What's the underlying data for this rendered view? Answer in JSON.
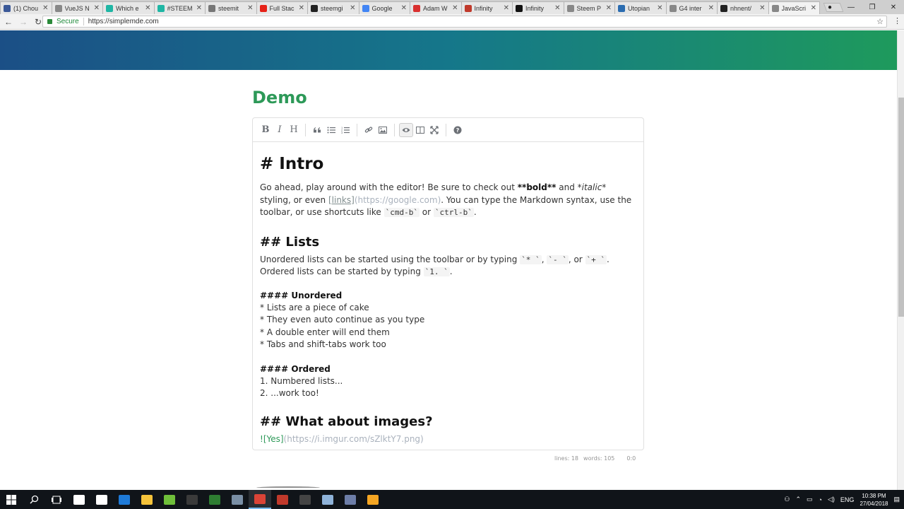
{
  "browser": {
    "tabs": [
      {
        "label": "(1) Chou",
        "color": "#3b5998"
      },
      {
        "label": "VueJS N",
        "color": "#888888"
      },
      {
        "label": "Which e",
        "color": "#1fb6a4"
      },
      {
        "label": "#STEEM",
        "color": "#1fb6a4"
      },
      {
        "label": "steemit",
        "color": "#777777"
      },
      {
        "label": "Full Stac",
        "color": "#e62117"
      },
      {
        "label": "steemgi",
        "color": "#222222"
      },
      {
        "label": "Google",
        "color": "#4285f4"
      },
      {
        "label": "Adam W",
        "color": "#d9302f"
      },
      {
        "label": "Infinity",
        "color": "#c0392b"
      },
      {
        "label": "Infinity",
        "color": "#111111"
      },
      {
        "label": "Steem P",
        "color": "#888888"
      },
      {
        "label": "Utopian",
        "color": "#2b6cb0"
      },
      {
        "label": "G4 inter",
        "color": "#888888"
      },
      {
        "label": "nhnent/",
        "color": "#222222"
      },
      {
        "label": "JavaScri",
        "color": "#888888",
        "active": true
      }
    ],
    "secure_label": "Secure",
    "url": "https://simplemde.com"
  },
  "page": {
    "title": "Demo"
  },
  "toolbar_icons": [
    {
      "name": "bold-icon",
      "glyph": "B"
    },
    {
      "name": "italic-icon",
      "glyph": "I"
    },
    {
      "name": "heading-icon",
      "glyph": "H"
    },
    {
      "name": "quote-icon",
      "glyph": "❝"
    },
    {
      "name": "unordered-list-icon",
      "glyph": "☰"
    },
    {
      "name": "ordered-list-icon",
      "glyph": "☷"
    },
    {
      "name": "link-icon",
      "glyph": "🔗"
    },
    {
      "name": "image-icon",
      "glyph": "▣"
    },
    {
      "name": "preview-icon",
      "glyph": "◉"
    },
    {
      "name": "side-by-side-icon",
      "glyph": "◫"
    },
    {
      "name": "fullscreen-icon",
      "glyph": "⤢"
    },
    {
      "name": "help-icon",
      "glyph": "?"
    }
  ],
  "editor": {
    "h1": "# Intro",
    "p1_a": "Go ahead, play around with the editor! Be sure to check out ",
    "p1_bold": "**bold**",
    "p1_b": " and ",
    "p1_italic": "*italic*",
    "p1_c": " styling, or even ",
    "p1_link_text": "[links]",
    "p1_link_url": "(https://google.com)",
    "p1_d": ". You can type the Markdown syntax, use the toolbar, or use shortcuts like ",
    "p1_code1": "`cmd-b`",
    "p1_e": " or ",
    "p1_code2": "`ctrl-b`",
    "p1_f": ".",
    "h2_lists": "## Lists",
    "p2_a": "Unordered lists can be started using the toolbar or by typing ",
    "p2_code1": "`* `",
    "p2_b": ", ",
    "p2_code2": "`- `",
    "p2_c": ", or ",
    "p2_code3": "`+ `",
    "p2_d": ". Ordered lists can be started by typing ",
    "p2_code4": "`1. `",
    "p2_e": ".",
    "h4_unordered": "#### Unordered",
    "unordered": [
      "* Lists are a piece of cake",
      "* They even auto continue as you type",
      "* A double enter will end them",
      "* Tabs and shift-tabs work too"
    ],
    "h4_ordered": "#### Ordered",
    "ordered": [
      "1. Numbered lists...",
      "2. ...work too!"
    ],
    "h2_images": "## What about images?",
    "img_bang": "!",
    "img_alt": "[Yes]",
    "img_url": "(https://i.imgur.com/sZlktY7.png)"
  },
  "status": {
    "lines": "lines: 18",
    "words": "words: 105",
    "cursor": "0:0"
  },
  "taskbar": {
    "time": "10:38 PM",
    "date": "27/04/2018",
    "lang": "ENG",
    "apps": [
      "#ffffff",
      "#ffffff",
      "#1e7ad7",
      "#f5c33b",
      "#6fbf3a",
      "#3a3a3a",
      "#2e7d32",
      "#7a8fa5",
      "#db4437",
      "#c0392b",
      "#444444",
      "#8fb3d9",
      "#6d7ea8",
      "#f5a623"
    ]
  }
}
